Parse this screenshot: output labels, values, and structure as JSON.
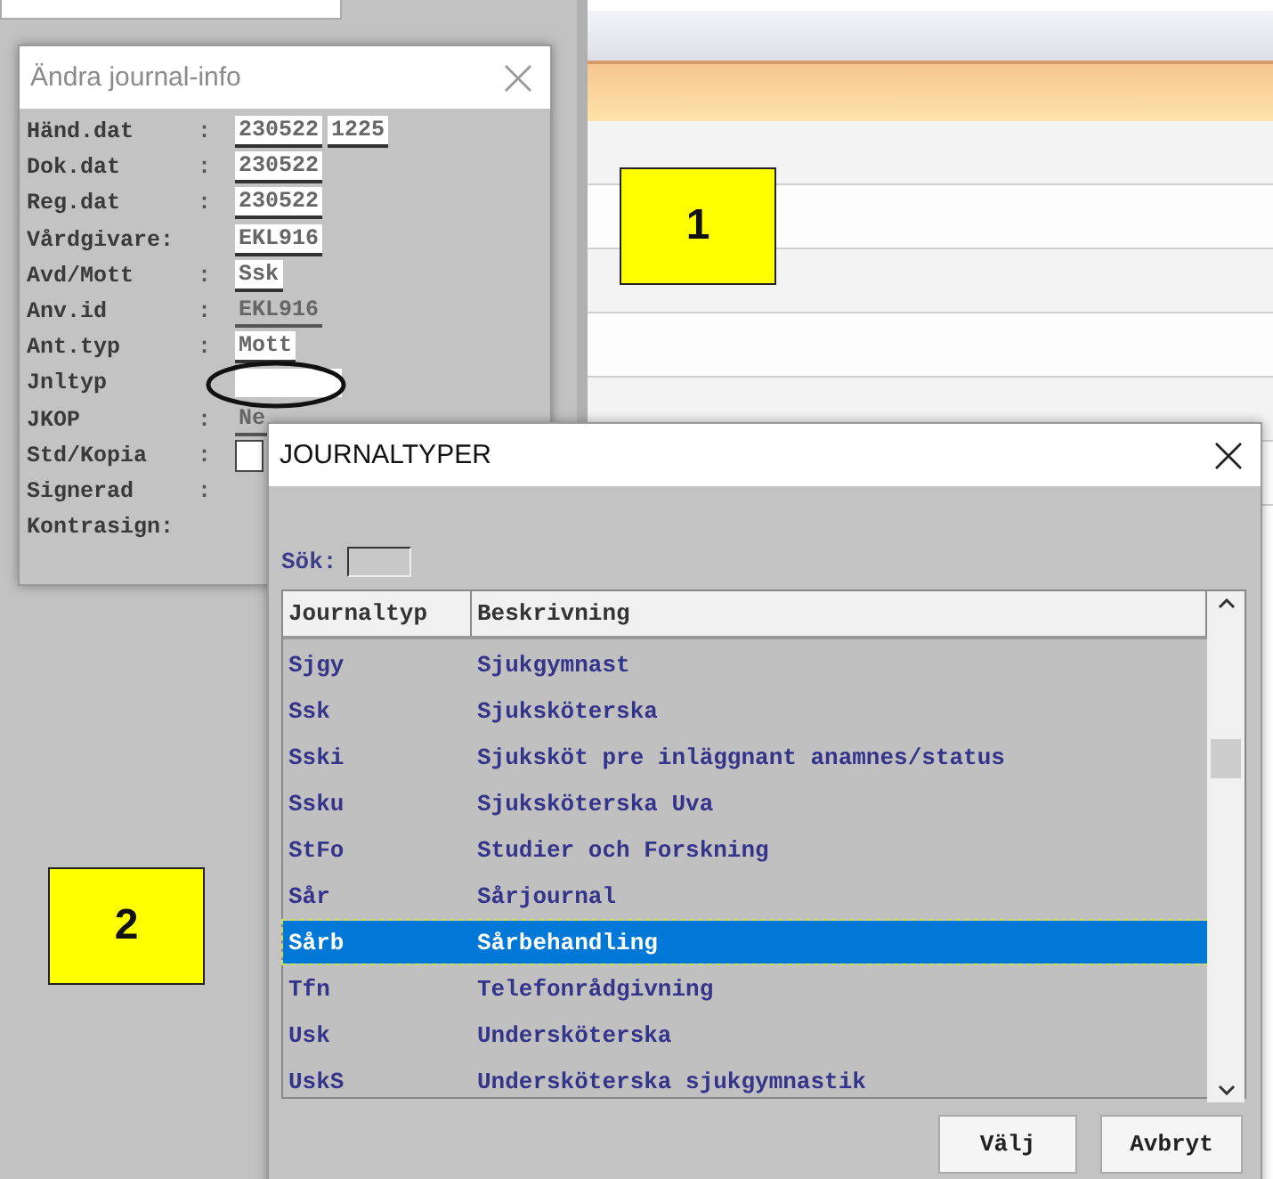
{
  "info_dialog": {
    "title": "Ändra journal-info",
    "fields": [
      {
        "label": "Händ.dat",
        "colon": ":",
        "kind": "field",
        "values": [
          "230522",
          "1225"
        ]
      },
      {
        "label": "Dok.dat",
        "colon": ":",
        "kind": "field",
        "values": [
          "230522"
        ]
      },
      {
        "label": "Reg.dat",
        "colon": ":",
        "kind": "field",
        "values": [
          "230522"
        ]
      },
      {
        "label": "Vårdgivare:",
        "kind": "field",
        "values": [
          "EKL916"
        ]
      },
      {
        "label": "Avd/Mott",
        "colon": ":",
        "kind": "field",
        "values": [
          "Ssk"
        ]
      },
      {
        "label": "Anv.id",
        "colon": ":",
        "kind": "text",
        "values": [
          "EKL916"
        ]
      },
      {
        "label": "Ant.typ",
        "colon": ":",
        "kind": "field",
        "values": [
          "Mott"
        ]
      },
      {
        "label": "Jnltyp",
        "kind": "field"
      },
      {
        "label": "JKOP",
        "colon": ":",
        "kind": "text",
        "values": [
          "Ne"
        ]
      },
      {
        "label": "Std/Kopia",
        "colon": ":",
        "kind": "checkbox",
        "checked": false
      },
      {
        "label": "Signerad",
        "colon": ":",
        "kind": "text"
      },
      {
        "label": "Kontrasign:",
        "kind": "text"
      }
    ]
  },
  "journal_dialog": {
    "title": "JOURNALTYPER",
    "search": {
      "label": "Sök:"
    },
    "table": {
      "columns": [
        "Journaltyp",
        "Beskrivning"
      ],
      "rows": [
        {
          "cells": [
            "Sjgy",
            "Sjukgymnast"
          ],
          "selected": false
        },
        {
          "cells": [
            "Ssk",
            "Sjuksköterska"
          ],
          "selected": false
        },
        {
          "cells": [
            "Sski",
            "Sjuksköt pre inläggnant anamnes/status"
          ],
          "selected": false
        },
        {
          "cells": [
            "Ssku",
            "Sjuksköterska Uva"
          ],
          "selected": false
        },
        {
          "cells": [
            "StFo",
            "Studier och Forskning"
          ],
          "selected": false
        },
        {
          "cells": [
            "Sår",
            "Sårjournal"
          ],
          "selected": false
        },
        {
          "cells": [
            "Sårb",
            "Sårbehandling"
          ],
          "selected": true
        },
        {
          "cells": [
            "Tfn",
            "Telefonrådgivning"
          ],
          "selected": false
        },
        {
          "cells": [
            "Usk",
            "Undersköterska"
          ],
          "selected": false
        },
        {
          "cells": [
            "UskS",
            "Undersköterska sjukgymnastik"
          ],
          "selected": false
        }
      ]
    },
    "buttons": [
      "Välj",
      "Avbryt"
    ]
  },
  "annotations": [
    {
      "label": "1"
    },
    {
      "label": "2"
    }
  ]
}
